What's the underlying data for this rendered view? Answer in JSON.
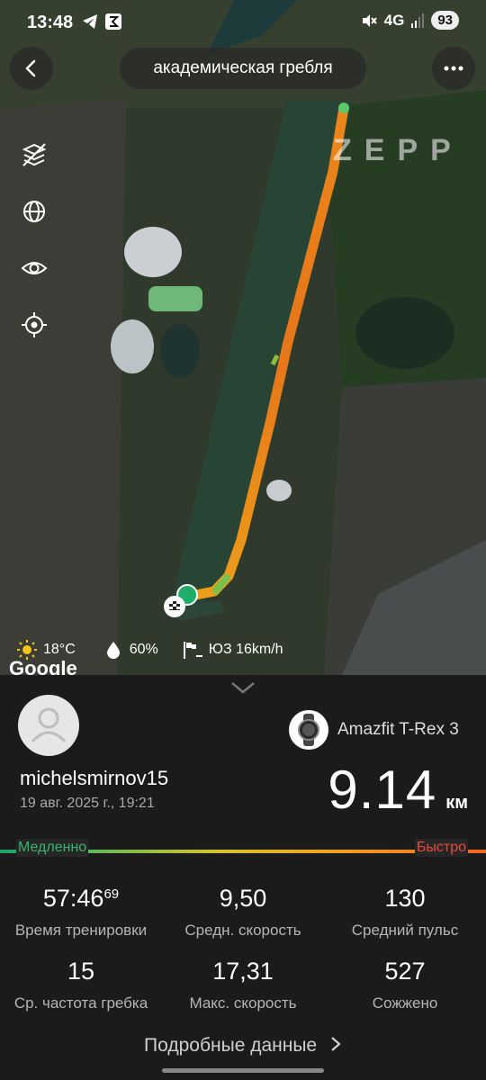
{
  "status_bar": {
    "time": "13:48",
    "network": "4G",
    "battery": "93"
  },
  "header": {
    "title": "академическая гребля"
  },
  "map": {
    "watermark": "ZEPP",
    "google_label": "Google",
    "side_icons": [
      "layers-off-icon",
      "globe-icon",
      "eye-icon",
      "locate-icon"
    ]
  },
  "weather": {
    "temperature": "18°C",
    "humidity": "60%",
    "wind": "ЮЗ 16km/h"
  },
  "user": {
    "name": "michelsmirnov15",
    "date": "19 авг. 2025 г., 19:21"
  },
  "device": {
    "name": "Amazfit T-Rex 3"
  },
  "distance": {
    "value": "9.14",
    "unit": "км"
  },
  "speed_scale": {
    "slow": "Медленно",
    "fast": "Быстро"
  },
  "stats": [
    {
      "value": "57:46",
      "sup": "69",
      "label": "Время тренировки"
    },
    {
      "value": "9,50",
      "sup": "",
      "label": "Средн. скорость"
    },
    {
      "value": "130",
      "sup": "",
      "label": "Средний пульс"
    },
    {
      "value": "15",
      "sup": "",
      "label": "Ср. частота гребка"
    },
    {
      "value": "17,31",
      "sup": "",
      "label": "Макс. скорость"
    },
    {
      "value": "527",
      "sup": "",
      "label": "Сожжено"
    }
  ],
  "more_button": {
    "label": "Подробные данные"
  }
}
